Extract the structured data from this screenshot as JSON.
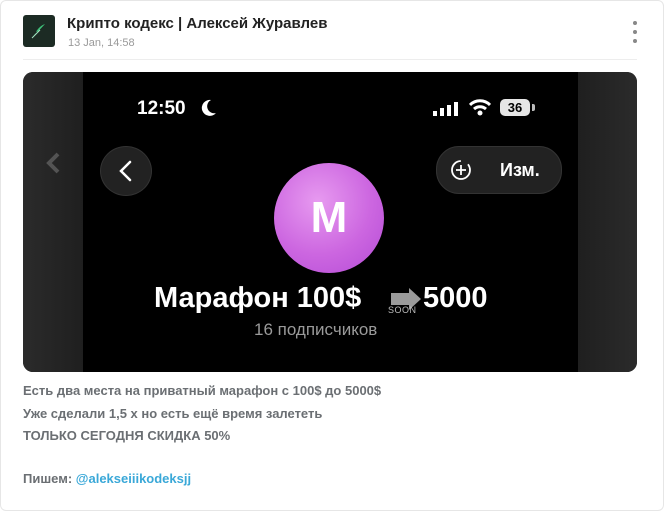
{
  "post": {
    "channel_title": "Крипто кодекс | Алексей Журавлев",
    "date": "13 Jan, 14:58",
    "brand_color": "#1c2b24"
  },
  "media": {
    "status_time": "12:50",
    "battery": "36",
    "edit_label": "Изм.",
    "profile_letter": "M",
    "profile_gradient": [
      "#e79af0",
      "#b44bd6"
    ],
    "headline_start": "Марафон 100$",
    "headline_end": "5000",
    "soon_label": "SOON",
    "subscribers": "16 подписчиков"
  },
  "body": {
    "line1": "Есть два места на приватный марафон с 100$ до 5000$",
    "line2": "Уже сделали 1,5 х но есть ещё время залететь",
    "line3": "ТОЛЬКО СЕГОДНЯ СКИДКА 50%",
    "line4_prefix": "Пишем: ",
    "mention": "@alekseiiikodeksjj",
    "mention_color": "#3aa8d8"
  }
}
